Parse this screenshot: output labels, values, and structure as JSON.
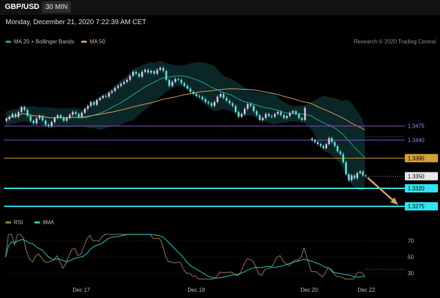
{
  "header": {
    "symbol": "GBP/USD",
    "timeframe": "30 MIN"
  },
  "datetime": "Monday, December 21, 2020 7:22:39 AM CET",
  "legend": {
    "ma20": {
      "label": "MA 20 + Bollinger Bands",
      "color": "#26a69a"
    },
    "ma50": {
      "label": "MA 50",
      "color": "#d4a15a"
    }
  },
  "credit": "Research © 2020 Trading Central",
  "rsi_legend": {
    "rsi": {
      "label": "RSI",
      "color": "#a07a45"
    },
    "ma": {
      "label": "9MA",
      "color": "#2ec8c8"
    }
  },
  "colors": {
    "up": "#d9c7ee",
    "down": "#5ee6dc",
    "band_fill": "#0c2a2a",
    "support": "#2ee6f2",
    "resistance": "#8a52c2",
    "pivot": "#d4a130",
    "arrow": "#d6a66a"
  },
  "chart_data": [
    {
      "type": "candlestick",
      "x_labels": [
        "Dec 17",
        "Dec 18",
        "Dec 20",
        "Dec 22"
      ],
      "levels": [
        {
          "value": "1.3475",
          "style": "resistance"
        },
        {
          "value": "1.3440",
          "style": "resistance"
        },
        {
          "value": "1.3395",
          "style": "pivot"
        },
        {
          "value": "1.3350",
          "style": "last"
        },
        {
          "value": "1.3320",
          "style": "support"
        },
        {
          "value": "1.3275",
          "style": "support"
        }
      ],
      "forecast": {
        "from": 1.335,
        "to": 1.3275,
        "direction": "down"
      },
      "ylim": [
        1.3265,
        1.366
      ],
      "close": [
        1.3492,
        1.3498,
        1.3505,
        1.3498,
        1.351,
        1.3522,
        1.3515,
        1.35,
        1.3488,
        1.3482,
        1.3494,
        1.35,
        1.3489,
        1.3478,
        1.3475,
        1.3485,
        1.3495,
        1.3502,
        1.3496,
        1.3488,
        1.3495,
        1.3503,
        1.351,
        1.3505,
        1.3498,
        1.3508,
        1.3518,
        1.3525,
        1.3535,
        1.3528,
        1.354,
        1.3545,
        1.355,
        1.3548,
        1.3558,
        1.3562,
        1.357,
        1.3575,
        1.358,
        1.3585,
        1.359,
        1.36,
        1.361,
        1.3605,
        1.3598,
        1.361,
        1.3615,
        1.3608,
        1.3612,
        1.3605,
        1.3615,
        1.362,
        1.3612,
        1.359,
        1.3575,
        1.3585,
        1.3592,
        1.359,
        1.3582,
        1.3575,
        1.3568,
        1.356,
        1.3555,
        1.355,
        1.3548,
        1.3542,
        1.3535,
        1.3532,
        1.3525,
        1.3535,
        1.3548,
        1.3555,
        1.3545,
        1.3538,
        1.3532,
        1.3525,
        1.351,
        1.3498,
        1.3505,
        1.3518,
        1.353,
        1.3525,
        1.3512,
        1.3502,
        1.349,
        1.3495,
        1.3505,
        1.35,
        1.3498,
        1.3505,
        1.351,
        1.3502,
        1.3495,
        1.35,
        1.3508,
        1.3512,
        1.3505,
        1.3495,
        1.349,
        1.352
      ],
      "close_gap_after": [
        1.344,
        1.3435,
        1.343,
        1.3425,
        1.342,
        1.343,
        1.3445,
        1.3435,
        1.3425,
        1.3412,
        1.3405,
        1.3385,
        1.3355,
        1.334,
        1.3352,
        1.3345,
        1.3358,
        1.3362,
        1.3352,
        1.335
      ],
      "rsi": {
        "levels": [
          "70",
          "50",
          "30"
        ],
        "ylim": [
          20,
          82
        ]
      }
    }
  ]
}
